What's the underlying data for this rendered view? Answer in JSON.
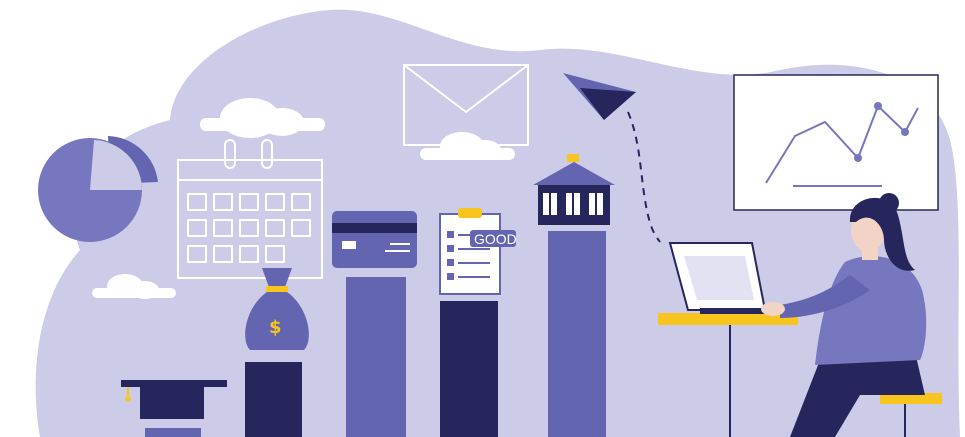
{
  "illustration": {
    "clipboard_badge": "GOOD",
    "money_bag_symbol": "$",
    "colors": {
      "background_blob": "#cccbe8",
      "bar_light": "#6465b1",
      "bar_dark": "#26265c",
      "accent_yellow": "#f7c51e",
      "cloud": "#ffffff"
    },
    "objects": [
      "pie-chart-icon",
      "calendar-icon",
      "money-bag-icon",
      "credit-card-icon",
      "clipboard-checklist-icon",
      "house-icon",
      "envelope-icon",
      "paper-plane-icon",
      "line-chart-board",
      "graduation-cap-icon",
      "woman-at-laptop"
    ]
  }
}
